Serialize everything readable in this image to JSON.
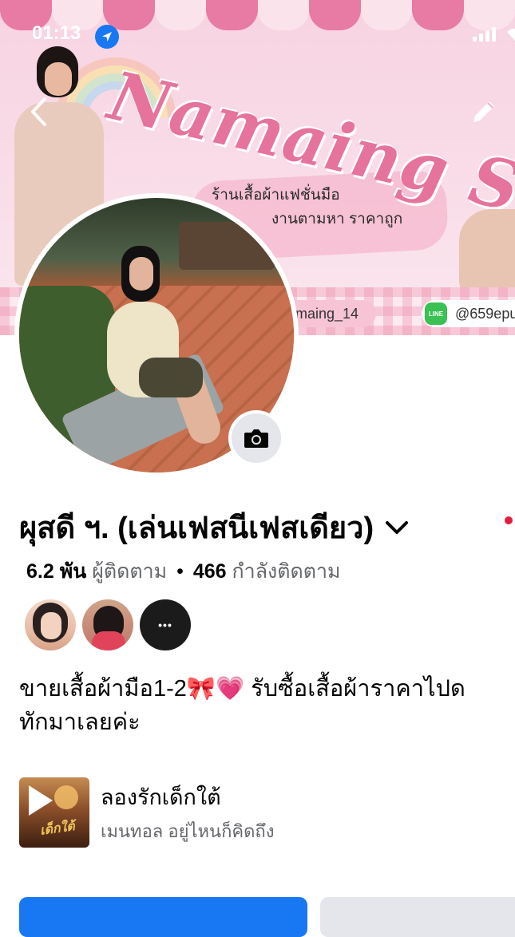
{
  "status_bar": {
    "time": "01:13"
  },
  "cover": {
    "shop_name": "Namaing Shop",
    "line1": "ร้านเสื้อผ้าแฟชั่นมือ",
    "line2": "งานตามหา ราคาถูก",
    "instagram_handle": "maing_14",
    "line_badge": "LINE",
    "line_id": "@659epu"
  },
  "profile": {
    "name": "ผุสดี ฯ. (เล่นเฟสนีเฟสเดียว)",
    "followers_count": "6.2 พัน",
    "followers_label": "ผู้ติดตาม",
    "separator": "•",
    "following_count": "466",
    "following_label": "กำลังติดตาม",
    "more_label": "•••",
    "bio_line1": "ขายเสื้อผ้ามือ1-2🎀💗 รับซื้อเสื้อผ้าราคาไปด",
    "bio_line2": "ทักมาเลยค่ะ"
  },
  "music": {
    "song": "ลองรักเด็กใต้",
    "artist": "เมนทอล อยู่ไหนก็คิดถึง",
    "album_text": "เด็กใต้"
  },
  "colors": {
    "accent": "#1877f2",
    "secondary_button": "#e4e6eb",
    "notification_dot": "#e41e3f"
  }
}
